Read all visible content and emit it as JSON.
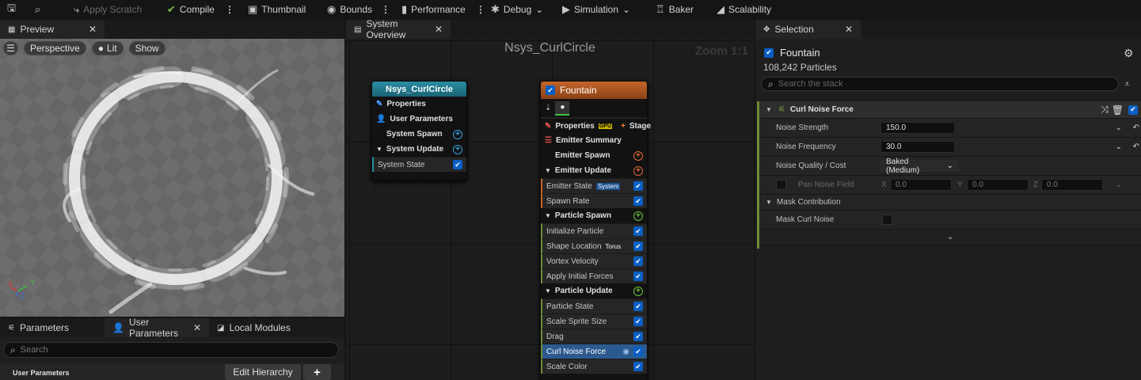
{
  "toolbar": {
    "apply_scratch": "Apply Scratch",
    "compile": "Compile",
    "thumbnail": "Thumbnail",
    "bounds": "Bounds",
    "performance": "Performance",
    "debug": "Debug",
    "simulation": "Simulation",
    "baker": "Baker",
    "scalability": "Scalability"
  },
  "preview": {
    "tab": "Preview",
    "perspective": "Perspective",
    "lit": "Lit",
    "show": "Show",
    "axis_x": "X",
    "axis_y": "Y",
    "axis_z": "Z"
  },
  "params_panel": {
    "tabs": [
      "Parameters",
      "User Parameters",
      "Local Modules"
    ],
    "search_placeholder": "Search",
    "section": "User Parameters",
    "edit_hierarchy": "Edit Hierarchy",
    "add": "+"
  },
  "graph": {
    "tab": "System Overview",
    "title": "Nsys_CurlCircle",
    "zoom": "Zoom 1:1",
    "system_node": {
      "title": "Nsys_CurlCircle",
      "properties": "Properties",
      "user_params": "User Parameters",
      "system_spawn": "System Spawn",
      "system_update": "System Update",
      "system_state": "System State"
    },
    "emitter_node": {
      "title": "Fountain",
      "properties": "Properties",
      "gpu": "GPU",
      "stage": "Stage",
      "summary": "Emitter Summary",
      "emitter_spawn": "Emitter Spawn",
      "emitter_update": "Emitter Update",
      "emitter_state": "Emitter State",
      "emitter_state_tag": "System",
      "spawn_rate": "Spawn Rate",
      "particle_spawn": "Particle Spawn",
      "initialize_particle": "Initialize Particle",
      "shape_location": "Shape Location",
      "shape_tag": "Torus",
      "vortex_velocity": "Vortex Velocity",
      "apply_initial_forces": "Apply Initial Forces",
      "particle_update": "Particle Update",
      "particle_state": "Particle State",
      "scale_sprite_size": "Scale Sprite Size",
      "drag": "Drag",
      "curl_noise_force": "Curl Noise Force",
      "scale_color": "Scale Color"
    }
  },
  "selection": {
    "tab": "Selection",
    "emitter": "Fountain",
    "particles": "108,242 Particles",
    "search_placeholder": "Search the stack",
    "module": "Curl Noise Force",
    "rows": [
      {
        "label": "Noise Strength",
        "value": "150.0"
      },
      {
        "label": "Noise Frequency",
        "value": "30.0"
      },
      {
        "label": "Noise Quality / Cost",
        "value": "Baked (Medium)"
      }
    ],
    "pan_noise": {
      "label": "Pan Noise Field",
      "x_label": "X",
      "x": "0.0",
      "y_label": "Y",
      "y": "0.0",
      "z_label": "Z",
      "z": "0.0"
    },
    "mask_section": "Mask Contribution",
    "mask_curl": "Mask Curl Noise"
  },
  "colors": {
    "accent": "#0a5fc4",
    "system_header": "#1f6e80",
    "emitter_header": "#a8521c",
    "module_bar": "#6f8c36"
  }
}
